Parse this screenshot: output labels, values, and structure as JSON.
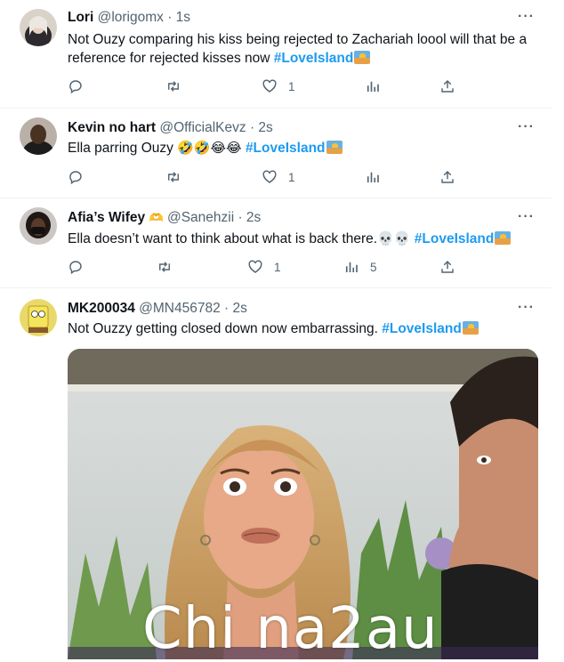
{
  "tweets": [
    {
      "name": "Lori",
      "handle": "@lorigomx · 1s",
      "text": "Not Ouzy comparing his kiss being rejected to Zachariah loool will that be a reference for rejected kisses now",
      "hashtag": "#LoveIsland",
      "likes": "1"
    },
    {
      "name": "Kevin no hart",
      "handle": "@OfficialKevz · 2s",
      "text": "Ella parring Ouzy",
      "emojis": "🤣🤣😂😂",
      "hashtag": "#LoveIsland",
      "likes": "1"
    },
    {
      "name": "Afia’s Wifey",
      "name_emoji": "🫶",
      "handle": "@Sanehzii · 2s",
      "text": "Ella doesn’t want to think about what is back there.",
      "emojis": "💀💀",
      "hashtag": "#LoveIsland",
      "likes": "1",
      "views": "5"
    },
    {
      "name": "MK200034",
      "handle": "@MN456782 · 2s",
      "text": "Not Ouzzy getting closed down now embarrassing.",
      "hashtag": "#LoveIsland"
    }
  ],
  "more_label": "···",
  "watermark": "Chi na2au",
  "icons": [
    "reply-icon",
    "retweet-icon",
    "like-icon",
    "views-icon",
    "share-icon",
    "more-icon"
  ],
  "colors": {
    "hashtag": "#1d9bf0",
    "secondary": "#536471",
    "divider": "#eff3f4"
  }
}
